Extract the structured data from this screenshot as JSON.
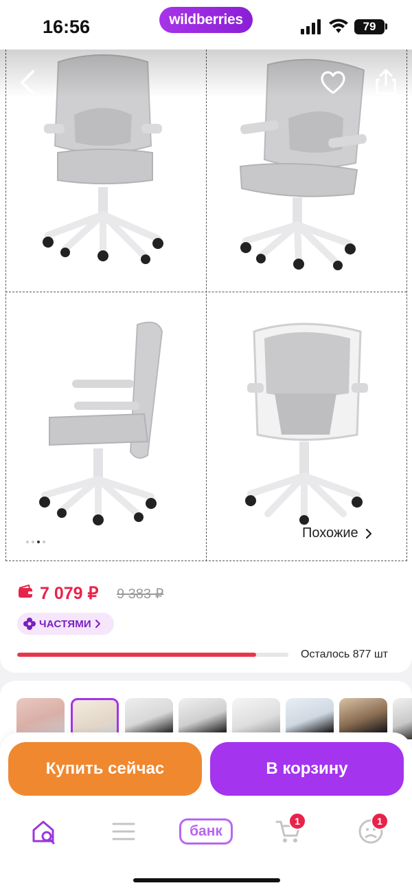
{
  "status_bar": {
    "time": "16:56",
    "brand": "wildberries",
    "battery": "79",
    "icons": [
      "signal-icon",
      "wifi-icon",
      "battery-icon"
    ]
  },
  "gallery": {
    "similar_label": "Похожие",
    "dots_count": 4,
    "active_dot": 2,
    "icons": [
      "back-icon",
      "heart-icon",
      "share-icon"
    ]
  },
  "price": {
    "current": "7 079 ₽",
    "old": "9 383 ₽",
    "parts_label": "ЧАСТЯМИ",
    "stock_text": "Осталось 877 шт",
    "stock_fraction": 0.88,
    "accent": "#e8234a"
  },
  "thumbs": {
    "count": 8,
    "selected_index": 1
  },
  "actions": {
    "buy_now": "Купить сейчас",
    "to_cart": "В корзину",
    "buy_color": "#f0882f",
    "cart_color": "#a534ee"
  },
  "nav": {
    "bank_label": "банк",
    "cart_badge": "1",
    "profile_badge": "1",
    "icons": [
      "home-search-icon",
      "catalog-icon",
      "bank-icon",
      "cart-icon",
      "profile-icon"
    ]
  }
}
